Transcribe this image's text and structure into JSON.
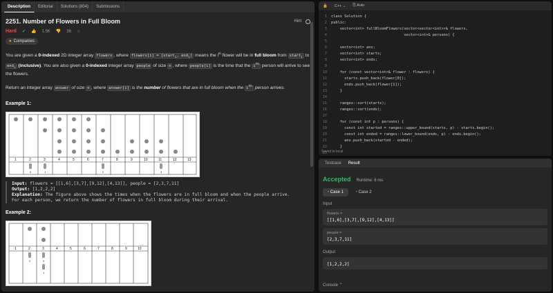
{
  "left": {
    "tabs": [
      "Description",
      "Editorial",
      "Solutions (804)",
      "Submissions"
    ],
    "problem_title": "2251. Number of Flowers in Full Bloom",
    "hint_label": "Hint",
    "difficulty": "Hard",
    "likes": "1.5K",
    "dislikes": "36",
    "companies_label": "Companies",
    "desc_p1_a": "You are given a ",
    "desc_p1_b": "0-indexed",
    "desc_p1_c": " 2D integer array ",
    "desc_p1_code1": "flowers",
    "desc_p1_d": ", where ",
    "desc_p1_code2": "flowers[i] = [start",
    "desc_p1_e": " means the ",
    "desc_p1_f": "flower will be in ",
    "desc_p1_g": "full bloom",
    "desc_p1_h": " from ",
    "desc_p1_i": "to ",
    "desc_p1_j": "(inclusive)",
    "desc_p1_k": ". You are also given a ",
    "desc_p1_l": "0-indexed",
    "desc_p1_m": " integer array ",
    "desc_p1_code3": "people",
    "desc_p1_n": " of size ",
    "desc_p1_o": ", where ",
    "desc_p1_code4": "people[i]",
    "desc_p1_p": " is the time that the ",
    "desc_p1_q": " person will arrive to see the flowers.",
    "desc_p2_a": "Return an integer array ",
    "desc_p2_code1": "answer",
    "desc_p2_b": " of size ",
    "desc_p2_c": ", where ",
    "desc_p2_code2": "answer[i]",
    "desc_p2_d": " is the ",
    "desc_p2_e": "number",
    "desc_p2_f": " of flowers that are in full bloom when the ",
    "desc_p2_g": " person arrives.",
    "example1_header": "Example 1:",
    "example1_input_label": "Input:",
    "example1_input": " flowers = [[1,6],[3,7],[9,12],[4,13]], people = [2,3,7,11]",
    "example1_output_label": "Output:",
    "example1_output": " [1,2,2,2]",
    "example1_expl_label": "Explanation:",
    "example1_expl": " The figure above shows the times when the flowers are in full bloom and when the people arrive.",
    "example1_expl2": "For each person, we return the number of flowers in full bloom during their arrival.",
    "example2_header": "Example 2:",
    "grid1_cols": [
      "1",
      "2",
      "3",
      "4",
      "5",
      "6",
      "7",
      "8",
      "9",
      "10",
      "11",
      "12",
      "13"
    ],
    "grid1_people": [
      "0",
      "1",
      "2",
      "3"
    ],
    "grid2_cols": [
      "1",
      "2",
      "3",
      "4",
      "5",
      "6",
      "7",
      "8",
      "9",
      "10"
    ],
    "grid2_people": [
      "2",
      "0",
      "1"
    ]
  },
  "editor": {
    "language": "C++",
    "mode": "Auto",
    "saved": "Saved to local",
    "lines": [
      "class Solution {",
      "public:",
      "    vector<int> fullBloomFlowers(vector<vector<int>>& flowers,",
      "                                 vector<int>& persons) {",
      "",
      "    vector<int> ans;",
      "    vector<int> starts;",
      "    vector<int> ends;",
      "",
      "    for (const vector<int>& flower : flowers) {",
      "      starts.push_back(flower[0]);",
      "      ends.push_back(flower[1]);",
      "    }",
      "",
      "    ranges::sort(starts);",
      "    ranges::sort(ends);",
      "",
      "    for (const int p : persons) {",
      "      const int started = ranges::upper_bound(starts, p) - starts.begin();",
      "      const int ended = ranges::lower_bound(ends, p) - ends.begin();",
      "      ans.push_back(started - ended);",
      "    }",
      "",
      "    return ans;"
    ],
    "line_numbers": [
      "1",
      "2",
      "3",
      "4",
      "5",
      "6",
      "7",
      "8",
      "9",
      "10",
      "11",
      "12",
      "13",
      "14",
      "15",
      "16",
      "17",
      "18",
      "19",
      "20",
      "21",
      "22",
      "23"
    ]
  },
  "result": {
    "tabs": [
      "Testcase",
      "Result"
    ],
    "status": "Accepted",
    "runtime": "Runtime: 6 ms",
    "cases": [
      "Case 1",
      "Case 2"
    ],
    "input_label": "Input",
    "var1_name": "flowers =",
    "var1_value": "[[1,6],[3,7],[9,12],[4,13]]",
    "var2_name": "people =",
    "var2_value": "[2,3,7,11]",
    "output_label": "Output",
    "output_value": "[1,2,2,2]",
    "console_label": "Console"
  },
  "colors": {
    "accent_green": "#2cbb5d",
    "hard_red": "#ef4743",
    "bg": "#262626"
  }
}
